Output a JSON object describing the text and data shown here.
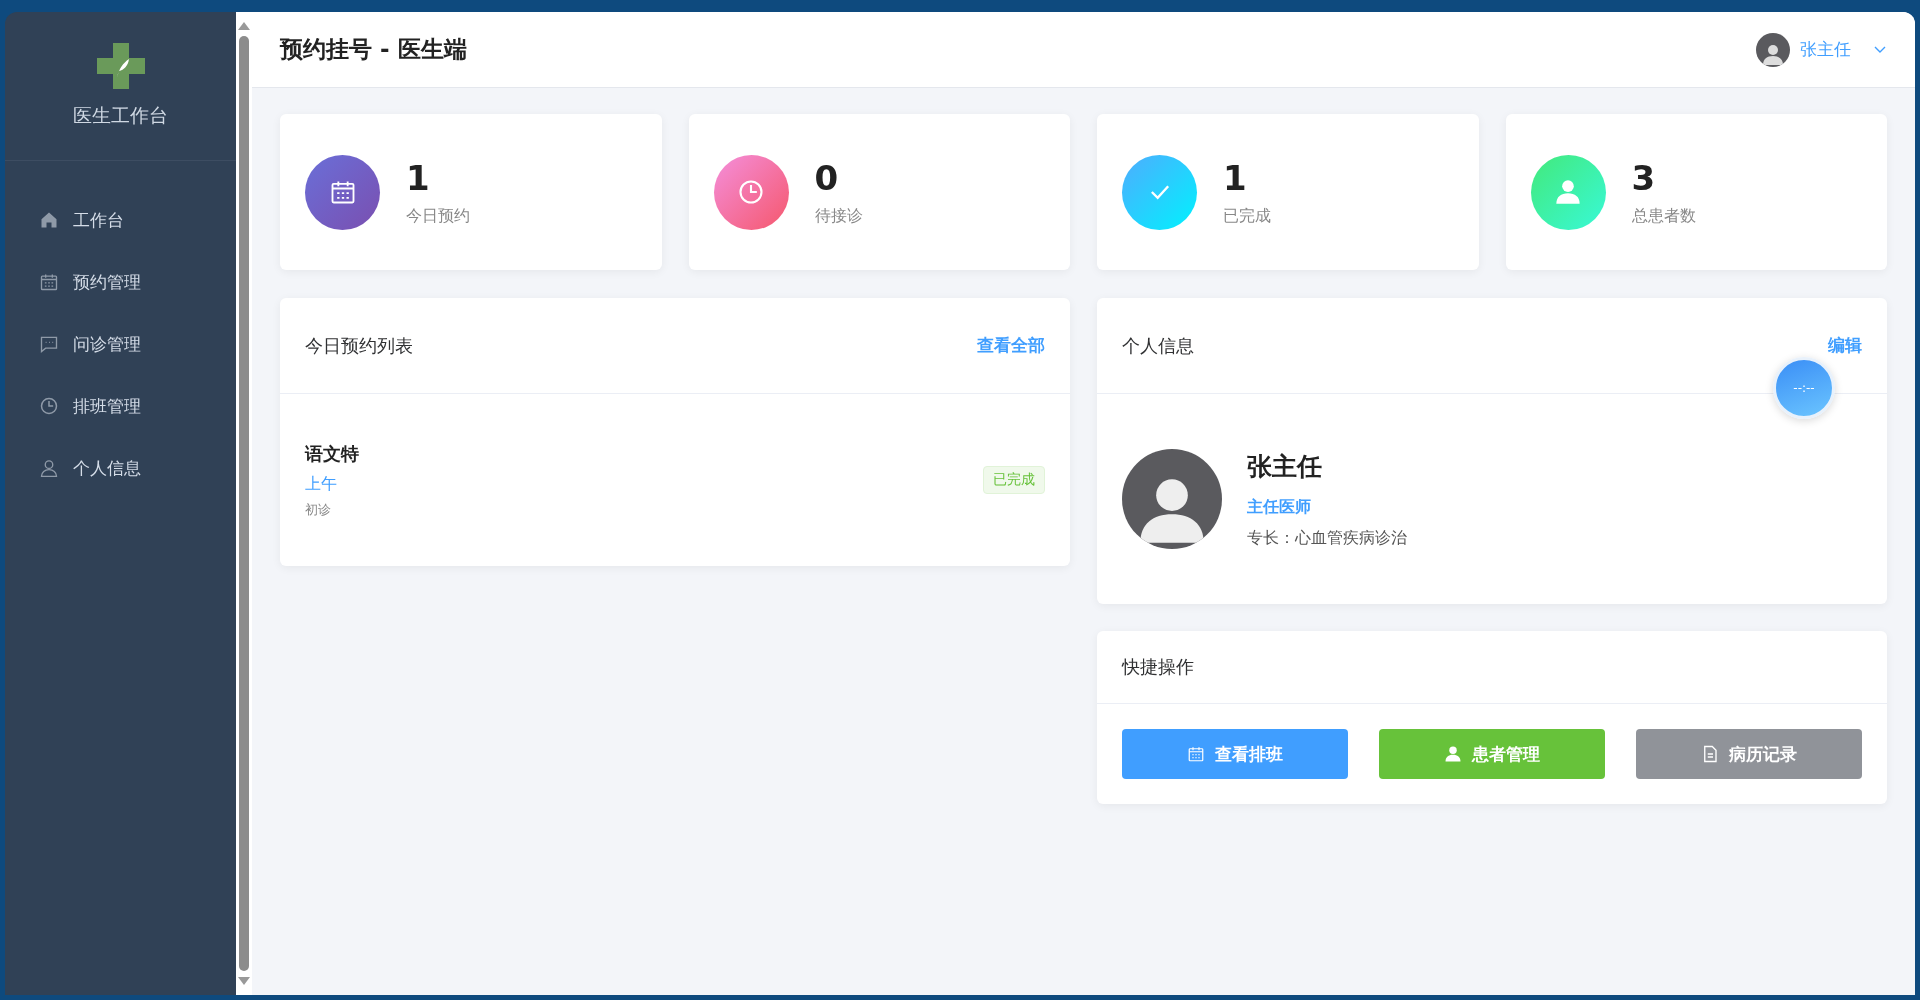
{
  "sidebar": {
    "title": "医生工作台",
    "items": [
      {
        "label": "工作台",
        "selected": false
      },
      {
        "label": "预约管理",
        "selected": false
      },
      {
        "label": "问诊管理",
        "selected": false
      },
      {
        "label": "排班管理",
        "selected": false
      },
      {
        "label": "个人信息",
        "selected": false
      }
    ]
  },
  "header": {
    "title": "预约挂号 - 医生端",
    "user": "张主任"
  },
  "stats": [
    {
      "kind": "calendar",
      "value": "1",
      "label": "今日预约"
    },
    {
      "kind": "clock",
      "value": "0",
      "label": "待接诊"
    },
    {
      "kind": "check",
      "value": "1",
      "label": "已完成"
    },
    {
      "kind": "user",
      "value": "3",
      "label": "总患者数"
    }
  ],
  "appointments": {
    "title": "今日预约列表",
    "link": "查看全部",
    "rows": [
      {
        "name": "语文特",
        "period": "上午",
        "type": "初诊",
        "status": "已完成",
        "kind": "done"
      }
    ]
  },
  "profile": {
    "title": "个人信息",
    "link": "编辑",
    "name": "张主任",
    "rank": "主任医师",
    "specialty": "专长：心血管疾病诊治"
  },
  "clock_widget": {
    "time": "--:--"
  },
  "quick_actions": {
    "title": "快捷操作",
    "buttons": [
      {
        "label": "查看排班",
        "kind": "primary"
      },
      {
        "label": "患者管理",
        "kind": "success"
      },
      {
        "label": "病历记录",
        "kind": "info"
      }
    ]
  }
}
